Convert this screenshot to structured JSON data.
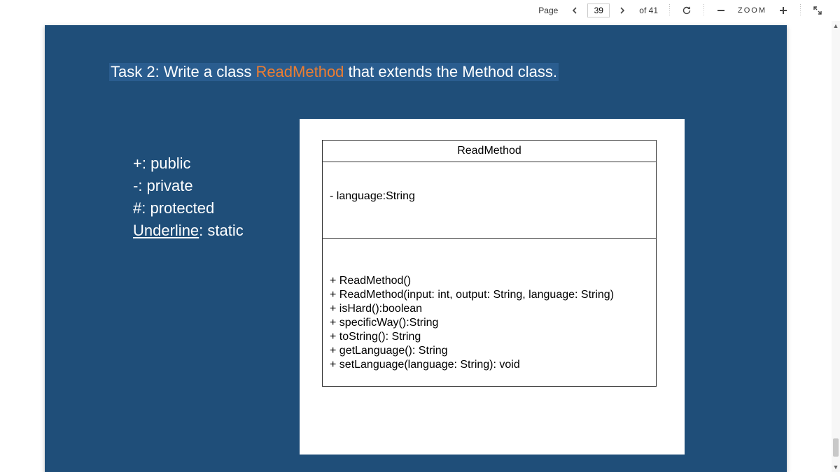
{
  "toolbar": {
    "page_label": "Page",
    "current_page": "39",
    "of_label": "of 41",
    "zoom_label": "ZOOM"
  },
  "slide": {
    "task_prefix": "Task 2: Write a class ",
    "task_classname": "ReadMethod",
    "task_suffix": " that extends the Method class.",
    "legend": {
      "public": "+:  public",
      "private": "-:  private",
      "protected": "#: protected",
      "static_label": "Underline",
      "static_suffix": ": static"
    },
    "uml": {
      "name": "ReadMethod",
      "attributes": [
        "- language:String"
      ],
      "operations": [
        "+ ReadMethod()",
        "+ ReadMethod(input: int, output: String, language: String)",
        "+ isHard():boolean",
        "+ specificWay():String",
        "+ toString(): String",
        "+ getLanguage(): String",
        "+ setLanguage(language: String): void"
      ]
    }
  }
}
